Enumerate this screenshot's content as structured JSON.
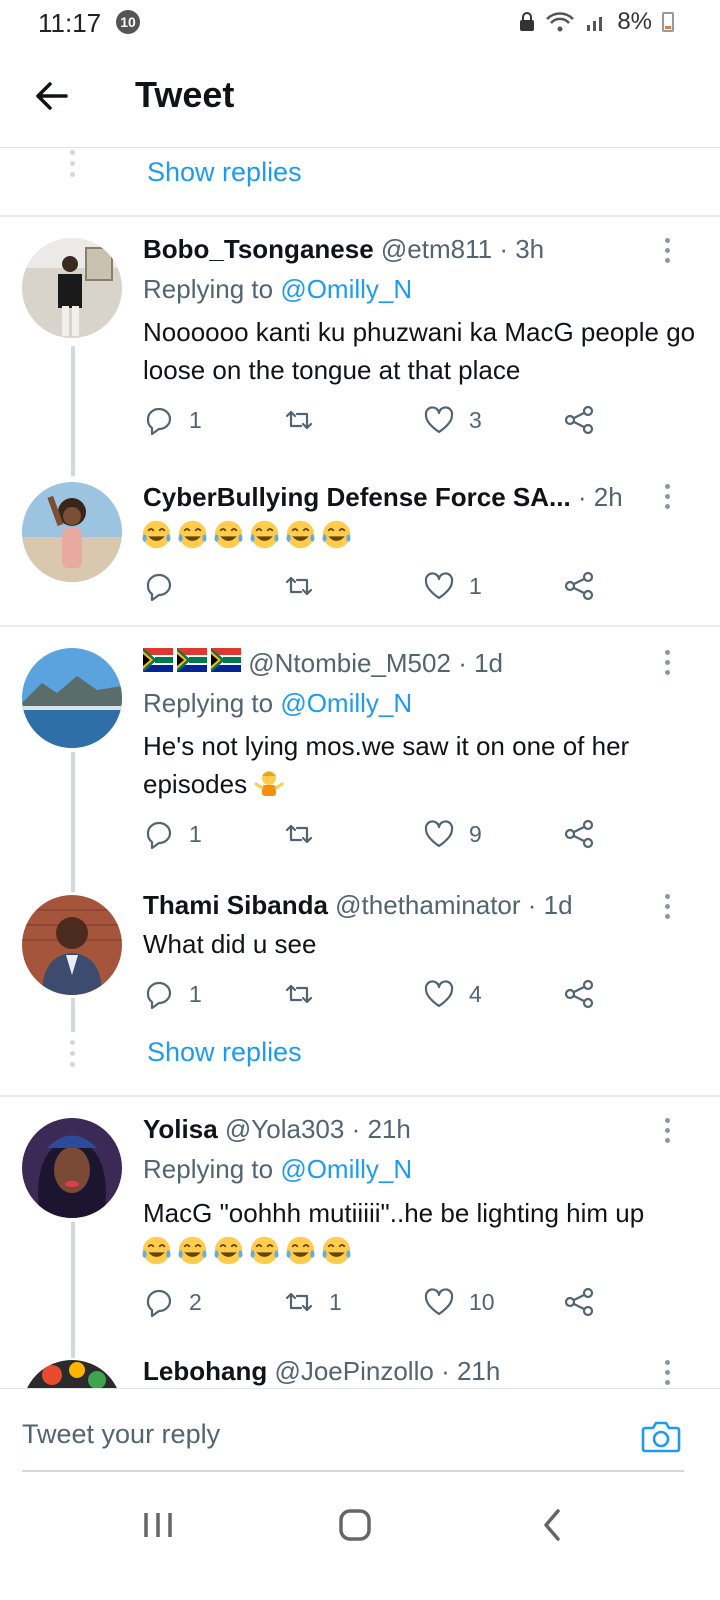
{
  "status": {
    "time": "11:17",
    "badge": "10",
    "battery": "8%"
  },
  "header": {
    "title": "Tweet"
  },
  "show_replies_label": "Show replies",
  "tweets": [
    {
      "name": "Bobo_Tsonganese",
      "handle": "@etm811",
      "time": "· 3h",
      "replying_prefix": "Replying to ",
      "replying_to": "@Omilly_N",
      "text": "Noooooo kanti ku phuzwani ka MacG people go loose on the tongue at that place",
      "replies": "1",
      "retweets": "",
      "likes": "3"
    },
    {
      "name": "CyberBullying Defense Force SA...",
      "handle": "",
      "time": "· 2h",
      "text": "",
      "emoji_count": 6,
      "replies": "",
      "retweets": "",
      "likes": "1"
    },
    {
      "name": "",
      "handle": "@Ntombie_M502",
      "time": "· 1d",
      "replying_prefix": "Replying to ",
      "replying_to": "@Omilly_N",
      "text": "He's not lying mos.we saw it on one of her episodes",
      "replies": "1",
      "retweets": "",
      "likes": "9"
    },
    {
      "name": "Thami Sibanda",
      "handle": "@thethaminator",
      "time": "· 1d",
      "text": "What did u see",
      "replies": "1",
      "retweets": "",
      "likes": "4"
    },
    {
      "name": "Yolisa",
      "handle": "@Yola303",
      "time": "· 21h",
      "replying_prefix": "Replying to ",
      "replying_to": "@Omilly_N",
      "text": "MacG \"oohhh mutiiiii\"..he be lighting him up",
      "emoji_count": 6,
      "replies": "2",
      "retweets": "1",
      "likes": "10"
    },
    {
      "name": "Lebohang",
      "handle": "@JoePinzollo",
      "time": "· 21h"
    }
  ],
  "reply_bar": {
    "placeholder": "Tweet your reply"
  },
  "icons": {
    "back": "arrow-left-icon",
    "camera": "camera-icon",
    "reply": "reply-icon",
    "retweet": "retweet-icon",
    "like": "heart-icon",
    "share": "share-icon"
  },
  "colors": {
    "accent": "#1d9bf0",
    "muted": "#536471"
  }
}
